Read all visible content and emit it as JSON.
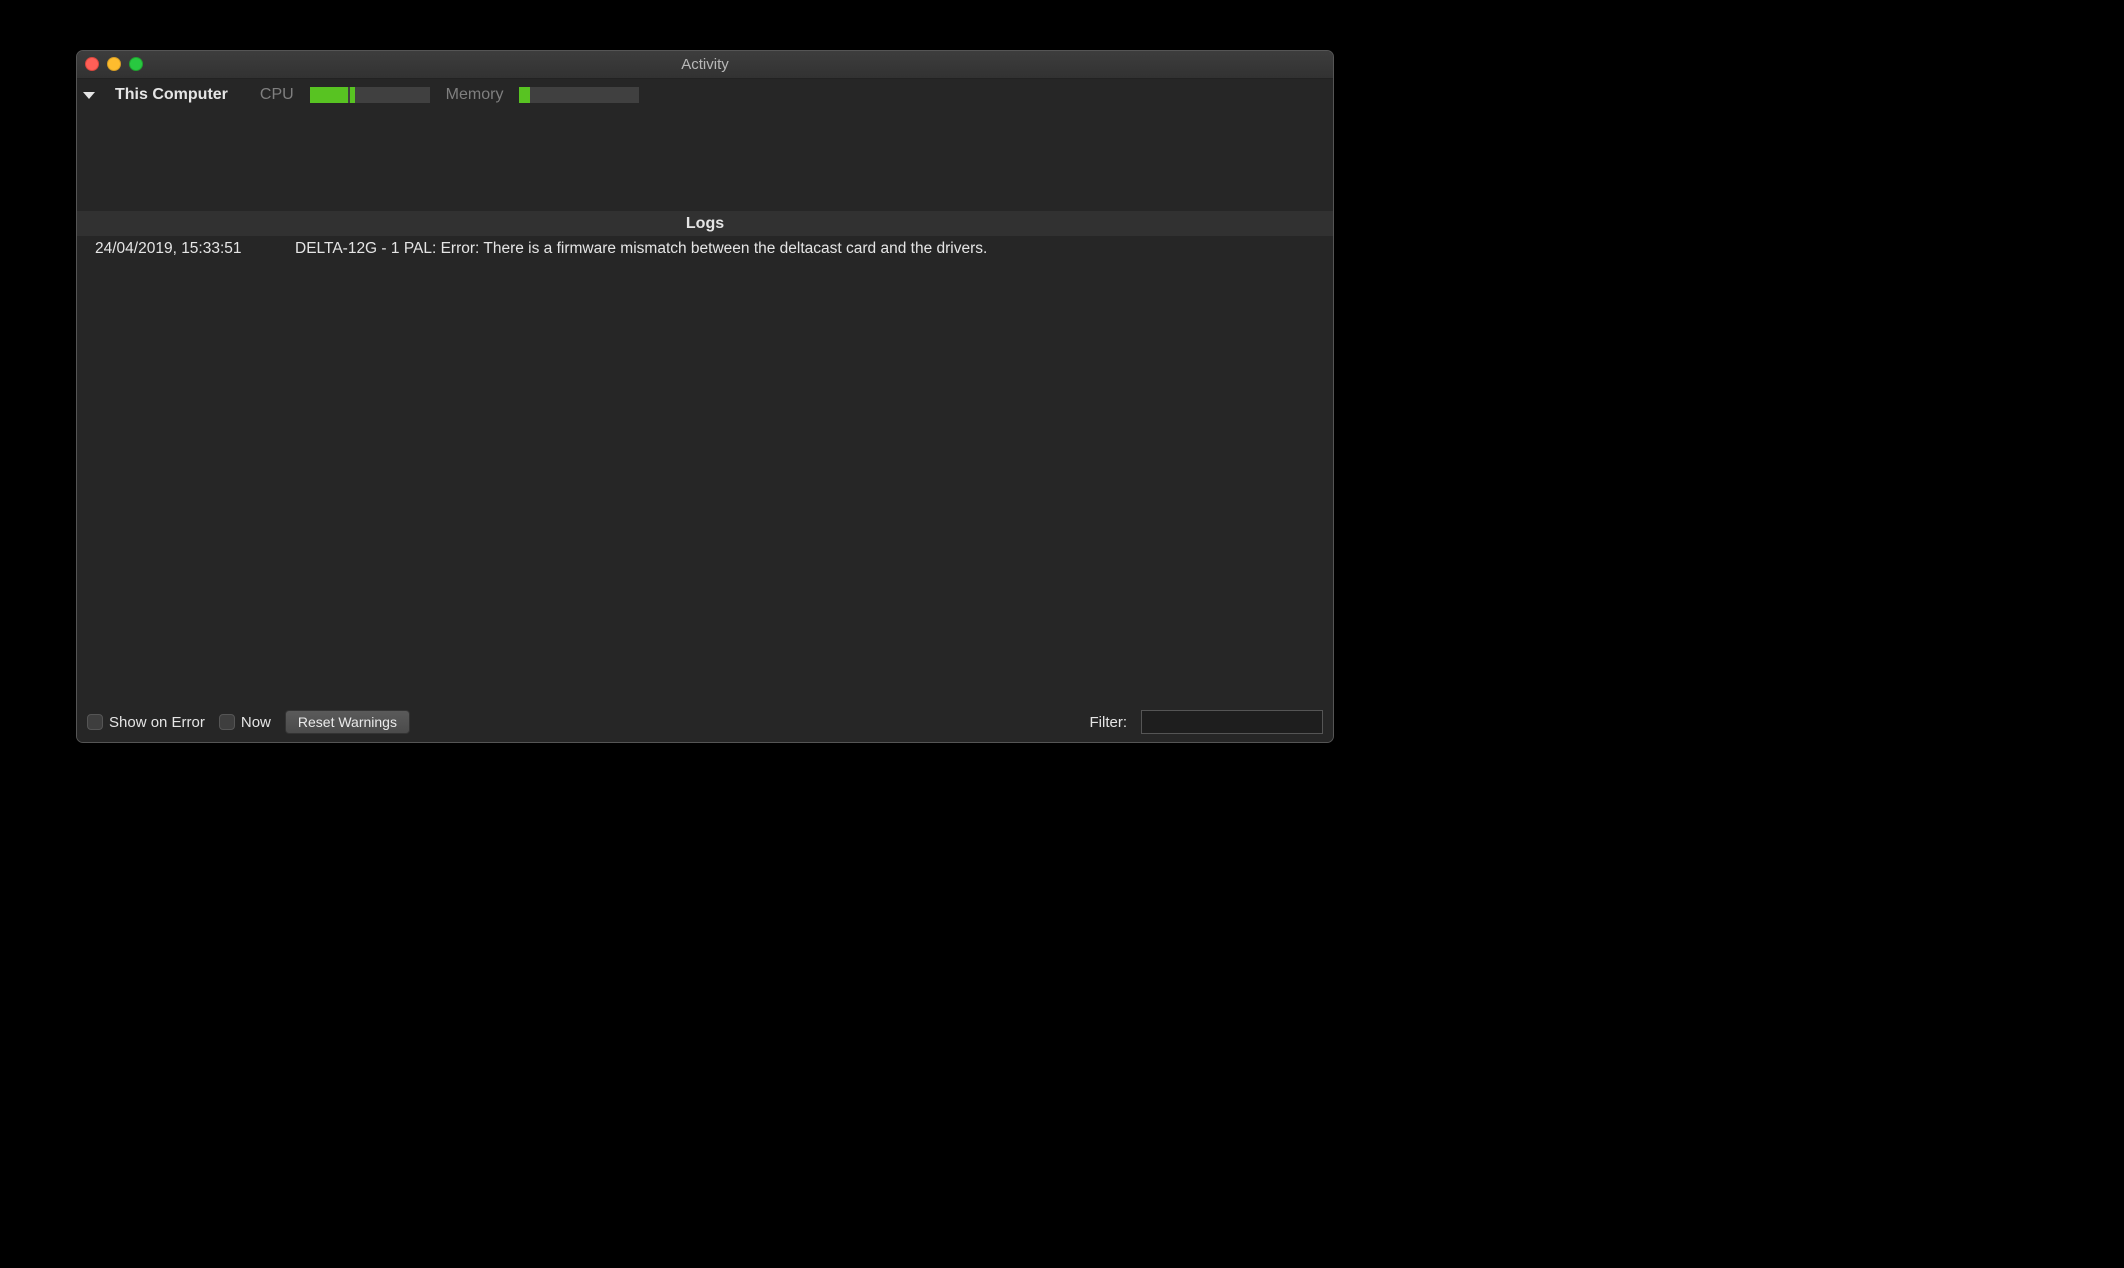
{
  "window": {
    "title": "Activity"
  },
  "meters": {
    "disclosure_open": true,
    "computer_label": "This Computer",
    "cpu": {
      "label": "CPU",
      "segments": [
        {
          "start_pct": 0,
          "width_pct": 32
        },
        {
          "start_pct": 34,
          "width_pct": 4
        }
      ]
    },
    "memory": {
      "label": "Memory",
      "segments": [
        {
          "start_pct": 0,
          "width_pct": 9
        }
      ]
    }
  },
  "logs": {
    "header": "Logs",
    "rows": [
      {
        "timestamp": "24/04/2019, 15:33:51",
        "message": "DELTA-12G - 1 PAL: Error: There is a firmware mismatch between the deltacast card and the drivers."
      }
    ]
  },
  "footer": {
    "show_on_error": {
      "checked": false,
      "label": "Show on Error"
    },
    "now": {
      "checked": false,
      "label": "Now"
    },
    "reset_warnings_label": "Reset Warnings",
    "filter": {
      "label": "Filter:",
      "value": ""
    }
  }
}
